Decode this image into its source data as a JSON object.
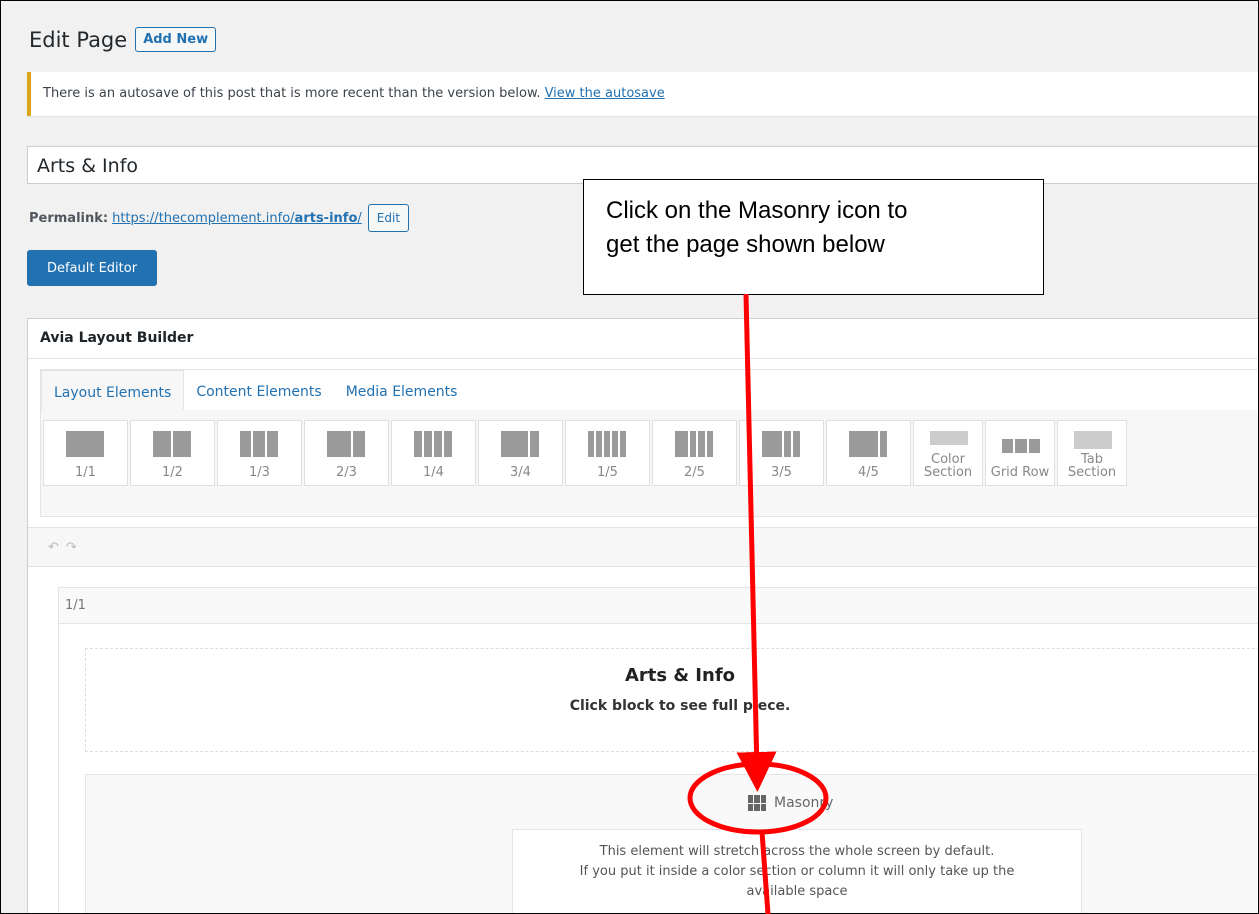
{
  "header": {
    "title": "Edit Page",
    "add_new": "Add New"
  },
  "notice": {
    "text": "There is an autosave of this post that is more recent than the version below.",
    "link": "View the autosave"
  },
  "post_title": "Arts & Info",
  "permalink": {
    "label": "Permalink:",
    "url_prefix": "https://thecomplement.info/",
    "slug": "arts-info",
    "url_suffix": "/",
    "edit": "Edit"
  },
  "default_editor": "Default Editor",
  "builder": {
    "title": "Avia Layout Builder",
    "tabs": [
      "Layout Elements",
      "Content Elements",
      "Media Elements"
    ],
    "elements": [
      "1/1",
      "1/2",
      "1/3",
      "2/3",
      "1/4",
      "3/4",
      "1/5",
      "2/5",
      "3/5",
      "4/5",
      "Color Section",
      "Grid Row",
      "Tab Section"
    ],
    "undo": "↶",
    "redo": "↷",
    "column_label": "1/1",
    "text_block": {
      "heading": "Arts & Info",
      "sub": "Click block to see full piece."
    },
    "masonry": {
      "label": "Masonry",
      "desc1": "This element will stretch across the whole screen by default.",
      "desc2": "If you put it inside a color section or column it will only take up the",
      "desc3": "available space"
    }
  },
  "callout": {
    "line1": "Click on the Masonry  icon to",
    "line2": "get the page shown below"
  },
  "colors": {
    "accent": "#2271b1",
    "annotation": "#ff0000",
    "notice_border": "#dba617"
  }
}
